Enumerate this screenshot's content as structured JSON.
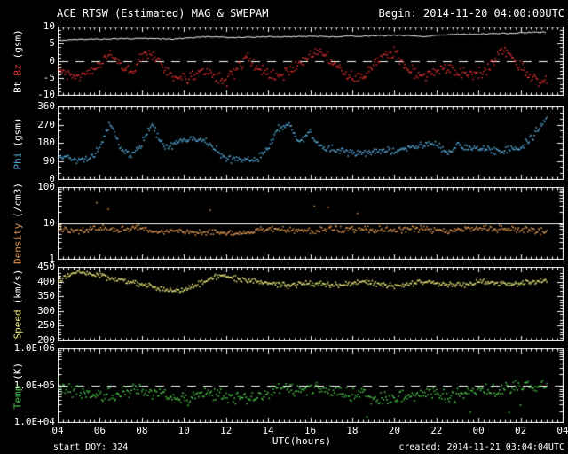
{
  "header": {
    "title": "ACE RTSW (Estimated) MAG & SWEPAM",
    "begin": "Begin: 2014-11-20 04:00:00UTC"
  },
  "footer": {
    "start_doy": "start DOY: 324",
    "created": "created: 2014-11-21 03:04:04UTC"
  },
  "x_axis": {
    "label": "UTC(hours)",
    "xlim": [
      4,
      28
    ],
    "tick_hours": [
      4,
      6,
      8,
      10,
      12,
      14,
      16,
      18,
      20,
      22,
      24,
      26,
      28
    ],
    "tick_labels": [
      "04",
      "06",
      "08",
      "10",
      "12",
      "14",
      "16",
      "18",
      "20",
      "22",
      "00",
      "02",
      "04"
    ],
    "minor_step": 0.25,
    "data_end_hour": 27.3
  },
  "chart_data": [
    {
      "name": "mag",
      "type": "scatter",
      "yscale": "linear",
      "ylim": [
        -10,
        10
      ],
      "yticks": [
        {
          "v": 10,
          "label": "10"
        },
        {
          "v": 5,
          "label": "5"
        },
        {
          "v": 0,
          "label": "0"
        },
        {
          "v": -5,
          "label": "-5"
        },
        {
          "v": -10,
          "label": "-10"
        }
      ],
      "yminor_step": 1,
      "ylabel": [
        {
          "text": "Bt",
          "color": "#ffffff"
        },
        {
          "text": "Bz",
          "color": "#e03030"
        },
        {
          "text": "(gsm)",
          "color": "#ffffff"
        }
      ],
      "refline": {
        "value": 0,
        "style": "dashed",
        "color": "#ffffff"
      },
      "series": [
        {
          "name": "Bt",
          "type": "line",
          "color": "#ffffff",
          "spread": 0.15,
          "x_start": 4,
          "x_step": 0.5,
          "y": [
            5.9,
            6.1,
            6.2,
            6.3,
            6.3,
            6.4,
            6.5,
            6.4,
            6.5,
            6.5,
            6.4,
            6.3,
            6.6,
            6.8,
            7.0,
            6.9,
            6.8,
            6.8,
            6.9,
            6.9,
            7.0,
            7.0,
            7.0,
            7.1,
            7.2,
            7.1,
            7.0,
            7.1,
            7.2,
            7.2,
            7.3,
            7.3,
            7.5,
            7.4,
            7.2,
            7.1,
            7.5,
            7.6,
            7.8,
            7.8,
            7.8,
            7.9,
            8.0,
            8.0,
            8.2,
            8.3,
            8.4,
            8.2
          ]
        },
        {
          "name": "Bz",
          "type": "scatter",
          "color": "#e03030",
          "spread": 1.3,
          "x_start": 4,
          "x_step": 0.5,
          "y": [
            -3,
            -4,
            -4.5,
            -3,
            -1,
            1.5,
            -1,
            -4,
            1,
            2,
            -2,
            -5,
            -5.5,
            -4,
            -3,
            -5,
            -5.8,
            -3,
            1,
            -2,
            -4,
            -5,
            -3,
            -1,
            2,
            3,
            0,
            -3,
            -5,
            -4,
            -2,
            2,
            2.5,
            -1,
            -3.5,
            -5,
            -3,
            -2,
            -3,
            -4,
            -3.5,
            -2.5,
            3,
            2,
            -2,
            -5,
            -6,
            -5.5
          ]
        }
      ]
    },
    {
      "name": "phi",
      "type": "scatter",
      "yscale": "linear",
      "ylim": [
        0,
        360
      ],
      "yticks": [
        {
          "v": 360,
          "label": "360"
        },
        {
          "v": 270,
          "label": "270"
        },
        {
          "v": 180,
          "label": "180"
        },
        {
          "v": 90,
          "label": "90"
        },
        {
          "v": 0,
          "label": "0"
        }
      ],
      "yminor_step": 30,
      "ylabel": [
        {
          "text": "Phi",
          "color": "#58acdc"
        },
        {
          "text": "(gsm)",
          "color": "#ffffff"
        }
      ],
      "refline": null,
      "series": [
        {
          "name": "Phi",
          "type": "scatter",
          "color": "#58acdc",
          "spread": 14,
          "x_start": 4,
          "x_step": 0.5,
          "y": [
            110,
            100,
            95,
            100,
            160,
            270,
            150,
            120,
            180,
            270,
            160,
            170,
            190,
            200,
            185,
            150,
            100,
            95,
            95,
            100,
            150,
            250,
            270,
            180,
            230,
            160,
            150,
            140,
            130,
            130,
            135,
            140,
            140,
            150,
            155,
            170,
            180,
            120,
            170,
            160,
            150,
            145,
            140,
            150,
            150,
            200,
            270,
            320
          ]
        }
      ]
    },
    {
      "name": "density",
      "type": "scatter",
      "yscale": "log",
      "ylim": [
        1,
        100
      ],
      "yticks": [
        {
          "v": 100,
          "label": "100"
        },
        {
          "v": 10,
          "label": "10"
        },
        {
          "v": 1,
          "label": "1"
        }
      ],
      "ylabel": [
        {
          "text": "Density",
          "color": "#dc9650"
        },
        {
          "text": "(/cm3)",
          "color": "#ffffff"
        }
      ],
      "refline": {
        "value": 10,
        "style": "solid",
        "color": "#ffffff"
      },
      "series": [
        {
          "name": "Density",
          "type": "scatter",
          "color": "#dc9650",
          "spread": 0.16,
          "x_start": 4,
          "x_step": 0.5,
          "outliers": {
            "prob": 0.012,
            "mult_min": 2.5,
            "mult_max": 6
          },
          "y": [
            7,
            6.5,
            6,
            6.5,
            7,
            6.8,
            6.5,
            7,
            6.8,
            6.2,
            5.8,
            6,
            6.2,
            5.8,
            5.5,
            6,
            5.2,
            5,
            5.5,
            6,
            6.2,
            6.5,
            6.3,
            6,
            6.2,
            6.5,
            6.8,
            7,
            7,
            6.8,
            6.5,
            6.2,
            6,
            6.5,
            7,
            6.8,
            6.2,
            6,
            6.5,
            7,
            7.2,
            7,
            6.8,
            6.5,
            6.3,
            6.2,
            6,
            5.8
          ]
        }
      ]
    },
    {
      "name": "speed",
      "type": "scatter",
      "yscale": "linear",
      "ylim": [
        200,
        450
      ],
      "yticks": [
        {
          "v": 450,
          "label": "450"
        },
        {
          "v": 400,
          "label": "400"
        },
        {
          "v": 350,
          "label": "350"
        },
        {
          "v": 300,
          "label": "300"
        },
        {
          "v": 250,
          "label": "250"
        },
        {
          "v": 200,
          "label": "200"
        }
      ],
      "yminor_step": 10,
      "ylabel": [
        {
          "text": "Speed",
          "color": "#e6e67a"
        },
        {
          "text": "(km/s)",
          "color": "#ffffff"
        }
      ],
      "refline": null,
      "series": [
        {
          "name": "Speed",
          "type": "scatter",
          "color": "#e6e67a",
          "spread": 7,
          "x_start": 4,
          "x_step": 0.5,
          "y": [
            400,
            420,
            432,
            428,
            420,
            412,
            405,
            398,
            390,
            382,
            375,
            368,
            372,
            385,
            400,
            415,
            418,
            410,
            405,
            400,
            396,
            390,
            386,
            390,
            395,
            392,
            388,
            390,
            394,
            398,
            395,
            390,
            386,
            390,
            395,
            400,
            396,
            392,
            390,
            393,
            396,
            400,
            395,
            391,
            393,
            398,
            403,
            406
          ]
        }
      ]
    },
    {
      "name": "temp",
      "type": "scatter",
      "yscale": "log",
      "ylim": [
        10000,
        1000000
      ],
      "yticks": [
        {
          "v": 1000000,
          "label": "1.0E+06"
        },
        {
          "v": 100000,
          "label": "1.0E+05"
        },
        {
          "v": 10000,
          "label": "1.0E+04"
        }
      ],
      "ylabel": [
        {
          "text": "Temp",
          "color": "#4ac44a"
        },
        {
          "text": "(K)",
          "color": "#ffffff"
        }
      ],
      "refline": {
        "value": 100000,
        "style": "dashed",
        "color": "#ffffff"
      },
      "series": [
        {
          "name": "Temp",
          "type": "scatter",
          "color": "#4ac44a",
          "spread": 0.32,
          "x_start": 4,
          "x_step": 0.5,
          "outliers": {
            "prob": 0.012,
            "mult_min": 0.2,
            "mult_max": 0.45
          },
          "y": [
            90000,
            80000,
            70000,
            60000,
            50000,
            55000,
            60000,
            70000,
            80000,
            60000,
            50000,
            45000,
            40000,
            50000,
            70000,
            60000,
            50000,
            45000,
            40000,
            50000,
            60000,
            70000,
            80000,
            70000,
            90000,
            80000,
            70000,
            60000,
            55000,
            50000,
            45000,
            40000,
            45000,
            50000,
            55000,
            60000,
            55000,
            50000,
            55000,
            60000,
            65000,
            70000,
            75000,
            80000,
            90000,
            100000,
            110000,
            100000
          ]
        }
      ]
    }
  ]
}
